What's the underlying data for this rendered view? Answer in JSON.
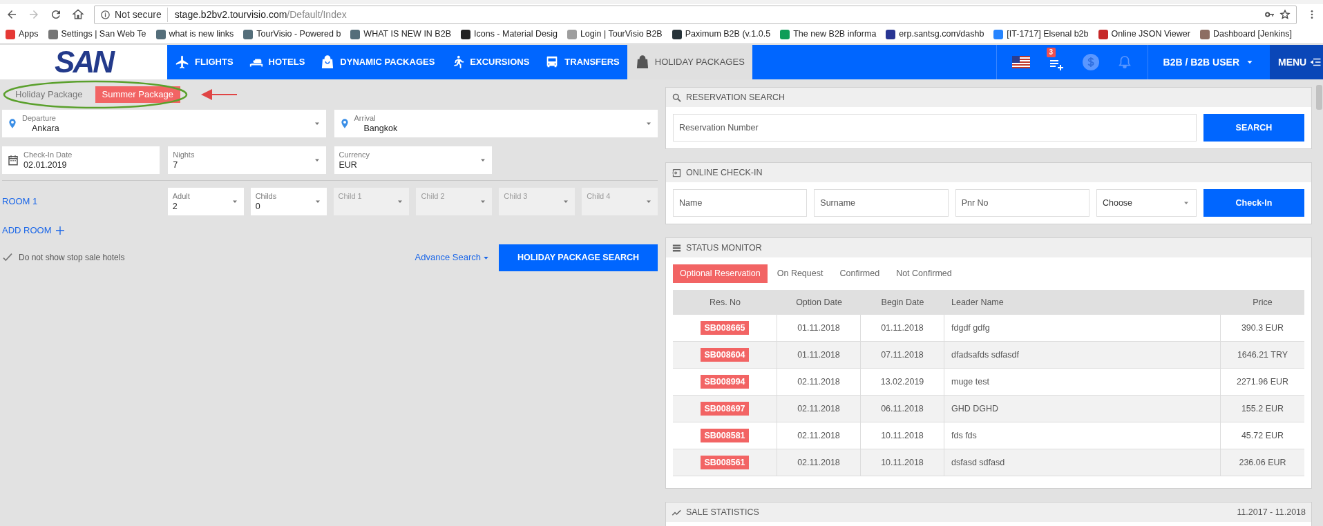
{
  "browser": {
    "security": "Not secure",
    "url_host": "stage.b2bv2.tourvisio.com",
    "url_path": "/Default/Index",
    "bookmarks": [
      {
        "label": "Apps",
        "color": "#e53935"
      },
      {
        "label": "Settings | San Web Te",
        "color": "#757575"
      },
      {
        "label": "what is new links",
        "color": "#546e7a"
      },
      {
        "label": "TourVisio - Powered b",
        "color": "#546e7a"
      },
      {
        "label": "WHAT IS NEW IN B2B",
        "color": "#546e7a"
      },
      {
        "label": "Icons - Material Desig",
        "color": "#212121"
      },
      {
        "label": "Login | TourVisio B2B",
        "color": "#9e9e9e"
      },
      {
        "label": "Paximum B2B (v.1.0.5",
        "color": "#263238"
      },
      {
        "label": "The new B2B informa",
        "color": "#0f9d58"
      },
      {
        "label": "erp.santsg.com/dashb",
        "color": "#283593"
      },
      {
        "label": "[IT-1717] Elsenal b2b",
        "color": "#2684ff"
      },
      {
        "label": "Online JSON Viewer",
        "color": "#c62828"
      },
      {
        "label": "Dashboard [Jenkins]",
        "color": "#8d6e63"
      }
    ]
  },
  "header": {
    "logo": "SAN",
    "nav": [
      {
        "label": "FLIGHTS",
        "selected": false
      },
      {
        "label": "HOTELS",
        "selected": false
      },
      {
        "label": "DYNAMIC PACKAGES",
        "selected": false
      },
      {
        "label": "EXCURSIONS",
        "selected": false
      },
      {
        "label": "TRANSFERS",
        "selected": false
      },
      {
        "label": "HOLIDAY PACKAGES",
        "selected": true
      }
    ],
    "cart_count": "3",
    "user": "B2B / B2B USER",
    "menu": "MENU"
  },
  "package_tabs": [
    {
      "label": "Holiday Package",
      "selected": false
    },
    {
      "label": "Summer Package",
      "selected": true
    }
  ],
  "search_form": {
    "row_1": [
      {
        "kind": "location",
        "label": "Departure",
        "value": "Ankara"
      },
      {
        "kind": "location",
        "label": "Arrival",
        "value": "Bangkok"
      }
    ],
    "row_2": [
      {
        "kind": "date",
        "label": "Check-In Date",
        "value": "02.01.2019"
      },
      {
        "kind": "select",
        "label": "Nights",
        "value": "7"
      },
      {
        "kind": "select",
        "label": "Currency",
        "value": "EUR"
      }
    ],
    "rooms": [
      {
        "label": "ROOM 1",
        "fields": [
          {
            "label": "Adult",
            "value": "2",
            "disabled": false
          },
          {
            "label": "Childs",
            "value": "0",
            "disabled": false
          },
          {
            "label": "Child 1",
            "disabled": true
          },
          {
            "label": "Child 2",
            "disabled": true
          },
          {
            "label": "Child 3",
            "disabled": true
          },
          {
            "label": "Child 4",
            "disabled": true
          }
        ]
      }
    ],
    "add_room": "ADD ROOM",
    "stop_sale": {
      "label": "Do not show stop sale hotels",
      "checked": true
    },
    "advance_search": "Advance Search",
    "search_button": "HOLIDAY PACKAGE SEARCH"
  },
  "reservation_search": {
    "title": "RESERVATION SEARCH",
    "placeholder": "Reservation Number",
    "button": "SEARCH"
  },
  "online_check_in": {
    "title": "ONLINE CHECK-IN",
    "fields": [
      {
        "kind": "text",
        "placeholder": "Name"
      },
      {
        "kind": "text",
        "placeholder": "Surname"
      },
      {
        "kind": "text",
        "placeholder": "Pnr No"
      },
      {
        "kind": "select",
        "value": "Choose"
      }
    ],
    "button": "Check-In"
  },
  "status_monitor": {
    "title": "STATUS MONITOR",
    "tabs": [
      {
        "label": "Optional Reservation",
        "selected": true
      },
      {
        "label": "On Request",
        "selected": false
      },
      {
        "label": "Confirmed",
        "selected": false
      },
      {
        "label": "Not Confirmed",
        "selected": false
      }
    ],
    "columns": [
      "Res. No",
      "Option Date",
      "Begin Date",
      "Leader Name",
      "Price"
    ],
    "rows": [
      [
        "SB008665",
        "01.11.2018",
        "01.11.2018",
        "fdgdf gdfg",
        "390.3 EUR"
      ],
      [
        "SB008604",
        "01.11.2018",
        "07.11.2018",
        "dfadsafds sdfasdf",
        "1646.21 TRY"
      ],
      [
        "SB008994",
        "02.11.2018",
        "13.02.2019",
        "muge test",
        "2271.96 EUR"
      ],
      [
        "SB008697",
        "02.11.2018",
        "06.11.2018",
        "GHD DGHD",
        "155.2 EUR"
      ],
      [
        "SB008581",
        "02.11.2018",
        "10.11.2018",
        "fds fds",
        "45.72 EUR"
      ],
      [
        "SB008561",
        "02.11.2018",
        "10.11.2018",
        "dsfasd sdfasd",
        "236.06 EUR"
      ]
    ]
  },
  "sale_statistics": {
    "title": "SALE STATISTICS",
    "range": "11.2017 - 11.2018"
  }
}
